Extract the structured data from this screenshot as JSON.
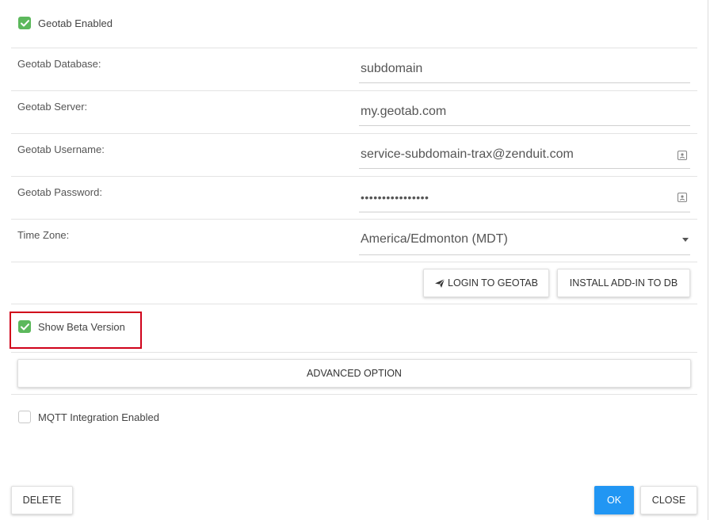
{
  "geotab_enabled": {
    "label": "Geotab Enabled",
    "checked": true
  },
  "fields": {
    "database": {
      "label": "Geotab Database:",
      "value": "subdomain"
    },
    "server": {
      "label": "Geotab Server:",
      "value": "my.geotab.com"
    },
    "username": {
      "label": "Geotab Username:",
      "value": "service-subdomain-trax@zenduit.com",
      "icon": "contact-card-icon"
    },
    "password": {
      "label": "Geotab Password:",
      "value": "••••••••••••••••",
      "icon": "contact-card-icon"
    },
    "timezone": {
      "label": "Time Zone:",
      "value": "America/Edmonton (MDT)",
      "icon": "caret-down-icon"
    }
  },
  "actions": {
    "login_label": "LOGIN TO GEOTAB",
    "login_icon": "paper-plane-icon",
    "install_label": "INSTALL ADD-IN TO DB"
  },
  "beta": {
    "label": "Show Beta Version",
    "checked": true
  },
  "advanced_label": "ADVANCED OPTION",
  "mqtt": {
    "label": "MQTT Integration Enabled",
    "checked": false
  },
  "footer": {
    "delete_label": "DELETE",
    "ok_label": "OK",
    "close_label": "CLOSE"
  },
  "colors": {
    "check_green": "#5cb85c",
    "primary_blue": "#2196f3",
    "highlight_red": "#d0021b"
  }
}
